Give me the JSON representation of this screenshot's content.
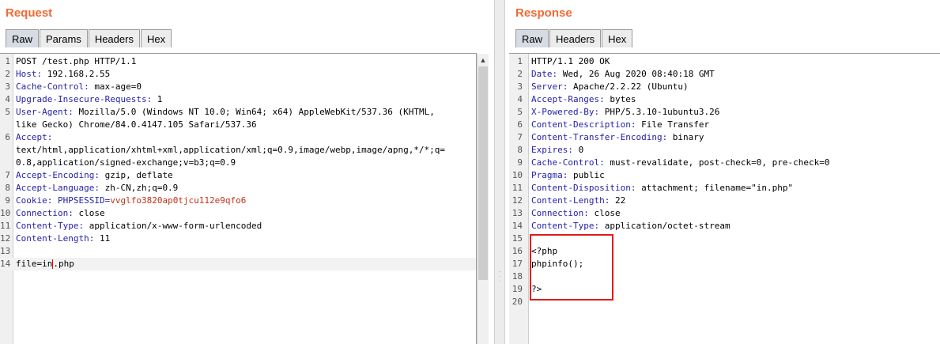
{
  "request": {
    "title": "Request",
    "tabs": [
      "Raw",
      "Params",
      "Headers",
      "Hex"
    ],
    "lines": [
      {
        "n": "1",
        "name": "",
        "value": "POST /test.php HTTP/1.1"
      },
      {
        "n": "2",
        "name": "Host:",
        "value": " 192.168.2.55"
      },
      {
        "n": "3",
        "name": "Cache-Control:",
        "value": " max-age=0"
      },
      {
        "n": "4",
        "name": "Upgrade-Insecure-Requests:",
        "value": " 1"
      },
      {
        "n": "5",
        "name": "User-Agent:",
        "value": " Mozilla/5.0 (Windows NT 10.0; Win64; x64) AppleWebKit/537.36 (KHTML,"
      },
      {
        "n": "",
        "name": "",
        "value": "like Gecko) Chrome/84.0.4147.105 Safari/537.36"
      },
      {
        "n": "6",
        "name": "Accept:",
        "value": ""
      },
      {
        "n": "",
        "name": "",
        "value": "text/html,application/xhtml+xml,application/xml;q=0.9,image/webp,image/apng,*/*;q="
      },
      {
        "n": "",
        "name": "",
        "value": "0.8,application/signed-exchange;v=b3;q=0.9"
      },
      {
        "n": "7",
        "name": "Accept-Encoding:",
        "value": " gzip, deflate"
      },
      {
        "n": "8",
        "name": "Accept-Language:",
        "value": " zh-CN,zh;q=0.9"
      },
      {
        "n": "9",
        "name": "Cookie:",
        "value": " ",
        "extra_name": "PHPSESSID=",
        "extra_value": "vvglfo3820ap0tjcu112e9qfo6"
      },
      {
        "n": "10",
        "name": "Connection:",
        "value": " close"
      },
      {
        "n": "11",
        "name": "Content-Type:",
        "value": " application/x-www-form-urlencoded"
      },
      {
        "n": "12",
        "name": "Content-Length:",
        "value": " 11"
      },
      {
        "n": "13",
        "name": "",
        "value": ""
      },
      {
        "n": "14",
        "name": "",
        "value": "file=in",
        "caret": true,
        "after_caret": ".php"
      }
    ]
  },
  "response": {
    "title": "Response",
    "tabs": [
      "Raw",
      "Headers",
      "Hex"
    ],
    "lines": [
      {
        "n": "1",
        "name": "",
        "value": "HTTP/1.1 200 OK"
      },
      {
        "n": "2",
        "name": "Date:",
        "value": " Wed, 26 Aug 2020 08:40:18 GMT"
      },
      {
        "n": "3",
        "name": "Server:",
        "value": " Apache/2.2.22 (Ubuntu)"
      },
      {
        "n": "4",
        "name": "Accept-Ranges:",
        "value": " bytes"
      },
      {
        "n": "5",
        "name": "X-Powered-By:",
        "value": " PHP/5.3.10-1ubuntu3.26"
      },
      {
        "n": "6",
        "name": "Content-Description:",
        "value": " File Transfer"
      },
      {
        "n": "7",
        "name": "Content-Transfer-Encoding:",
        "value": " binary"
      },
      {
        "n": "8",
        "name": "Expires:",
        "value": " 0"
      },
      {
        "n": "9",
        "name": "Cache-Control:",
        "value": " must-revalidate, post-check=0, pre-check=0"
      },
      {
        "n": "10",
        "name": "Pragma:",
        "value": " public"
      },
      {
        "n": "11",
        "name": "Content-Disposition:",
        "value": " attachment; filename=\"in.php\""
      },
      {
        "n": "12",
        "name": "Content-Length:",
        "value": " 22"
      },
      {
        "n": "13",
        "name": "Connection:",
        "value": " close"
      },
      {
        "n": "14",
        "name": "Content-Type:",
        "value": " application/octet-stream"
      },
      {
        "n": "15",
        "name": "",
        "value": ""
      },
      {
        "n": "16",
        "name": "",
        "value": "<?php"
      },
      {
        "n": "17",
        "name": "",
        "value": "phpinfo();"
      },
      {
        "n": "18",
        "name": "",
        "value": ""
      },
      {
        "n": "19",
        "name": "",
        "value": "?>"
      },
      {
        "n": "20",
        "name": "",
        "value": ""
      }
    ]
  },
  "colors": {
    "title": "#f26a34",
    "header_name": "#1f1fa8",
    "cookie_value": "#c0311a",
    "highlight_box": "#e21a1a"
  }
}
